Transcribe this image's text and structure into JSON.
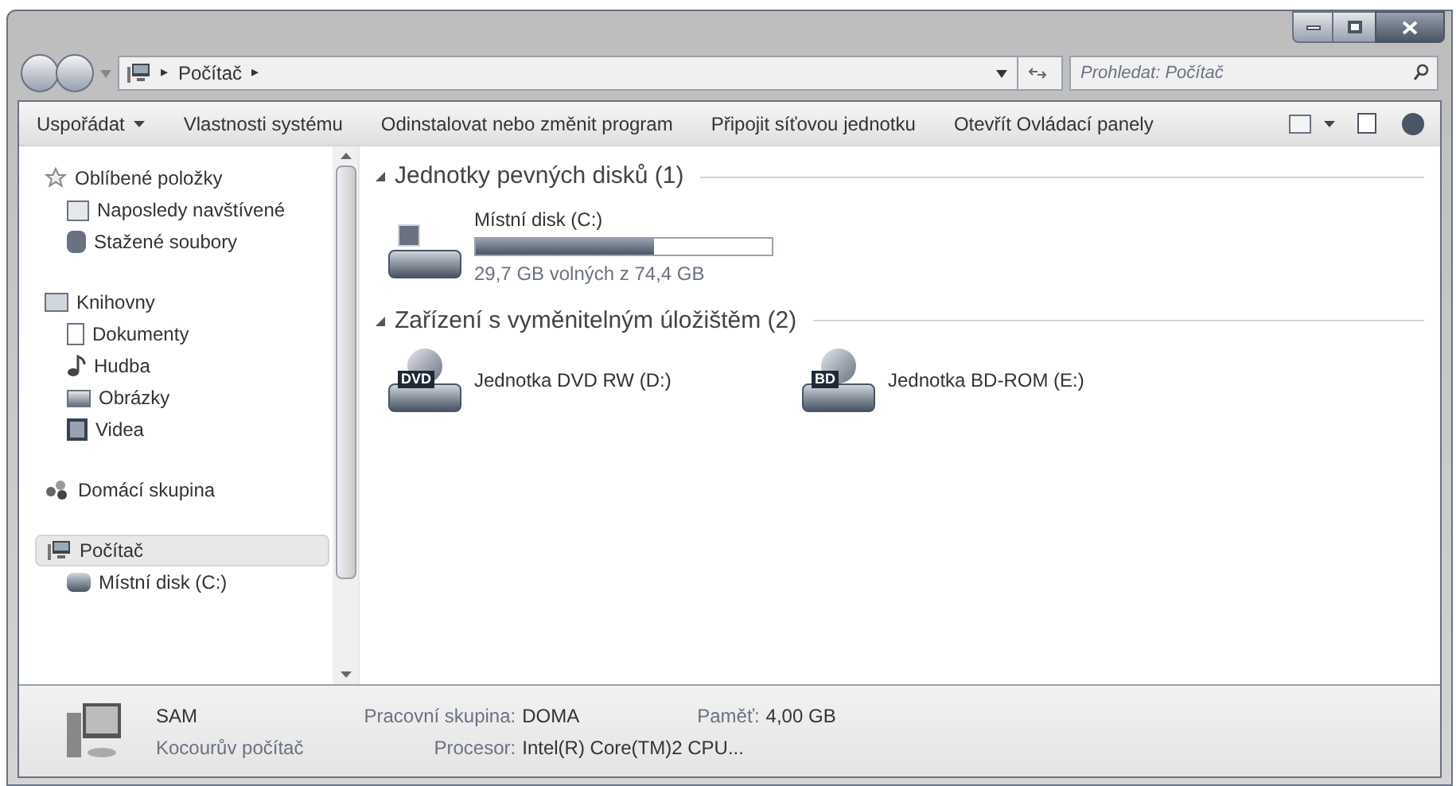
{
  "address_bar": {
    "crumbs": [
      "Počítač"
    ],
    "separator": "▸"
  },
  "search": {
    "placeholder": "Prohledat: Počítač"
  },
  "toolbar": {
    "buttons": [
      {
        "label": "Uspořádat",
        "dropdown": true
      },
      {
        "label": "Vlastnosti systému",
        "dropdown": false
      },
      {
        "label": "Odinstalovat nebo změnit program",
        "dropdown": false
      },
      {
        "label": "Připojit síťovou jednotku",
        "dropdown": false
      },
      {
        "label": "Otevřít Ovládací panely",
        "dropdown": false
      }
    ]
  },
  "sidebar": {
    "groups": [
      {
        "label": "Oblíbené položky",
        "kind": "star",
        "selected": false,
        "children": [
          {
            "label": "Naposledy navštívené",
            "kind": "recent",
            "selected": false
          },
          {
            "label": "Stažené soubory",
            "kind": "download",
            "selected": false
          }
        ]
      },
      {
        "label": "Knihovny",
        "kind": "library",
        "selected": false,
        "children": [
          {
            "label": "Dokumenty",
            "kind": "document",
            "selected": false
          },
          {
            "label": "Hudba",
            "kind": "music",
            "selected": false
          },
          {
            "label": "Obrázky",
            "kind": "picture",
            "selected": false
          },
          {
            "label": "Videa",
            "kind": "video",
            "selected": false
          }
        ]
      },
      {
        "label": "Domácí skupina",
        "kind": "homegroup",
        "selected": false
      },
      {
        "label": "Počítač",
        "kind": "computer",
        "selected": true,
        "children": [
          {
            "label": "Místní disk (C:)",
            "kind": "disk",
            "selected": false
          }
        ]
      }
    ]
  },
  "sections": [
    {
      "title": "Jednotky pevných disků (1)",
      "items": [
        {
          "kind": "hdd",
          "name": "Místní disk (C:)",
          "level": 0.6,
          "free": "29,7 GB volných z 74,4 GB"
        }
      ]
    },
    {
      "title": "Zařízení s vyměnitelným úložištěm (2)",
      "items": [
        {
          "kind": "dvd",
          "name": "Jednotka DVD RW (D:)",
          "badge": "DVD"
        },
        {
          "kind": "bd",
          "name": "Jednotka BD-ROM (E:)",
          "badge": "BD"
        }
      ]
    }
  ],
  "details": {
    "name": "SAM",
    "description": "Kocourův počítač",
    "fields": [
      {
        "label": "Pracovní skupina:",
        "value": "DOMA"
      },
      {
        "label": "Paměť:",
        "value": "4,00 GB"
      },
      {
        "label": "Procesor:",
        "value": "Intel(R) Core(TM)2 CPU..."
      }
    ]
  }
}
